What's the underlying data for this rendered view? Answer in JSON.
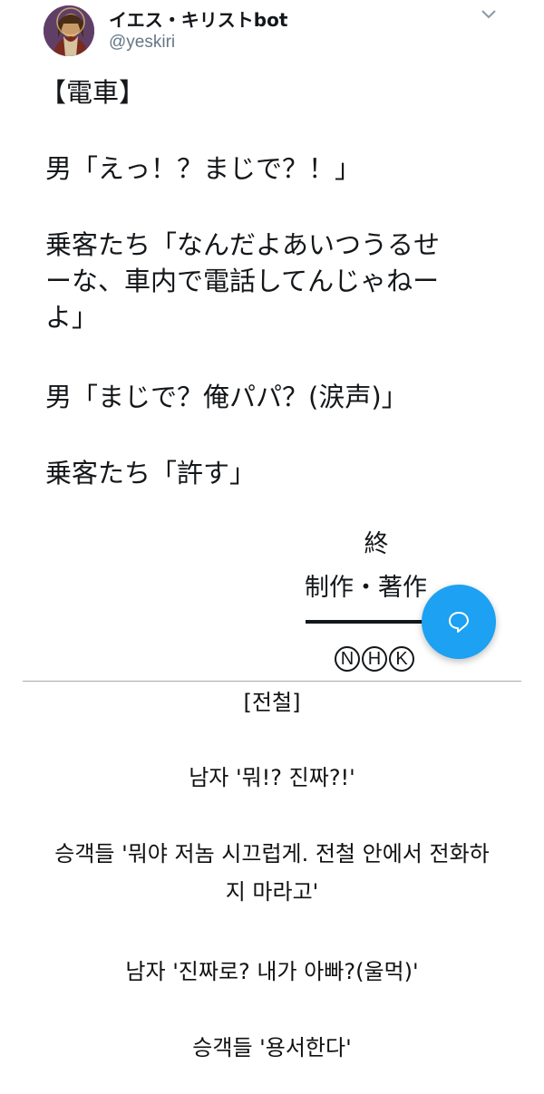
{
  "tweet": {
    "display_name": "イエス・キリストbot",
    "handle": "@yeskiri",
    "colors": {
      "avatar_bg": "#8a5ac6",
      "handle": "#657786",
      "accent": "#1da1f2"
    }
  },
  "japanese": {
    "title": "【電車】",
    "line1": "男「えっ！？まじで？！」",
    "line2_a": "乗客たち「なんだよあいつうるせ",
    "line2_b": "ーな、車内で電話してんじゃねー",
    "line2_c": "よ」",
    "line3": "男「まじで？俺パパ？(涙声)」",
    "line4": "乗客たち「許す」",
    "ending": "終",
    "credit": "制作・著作",
    "nhk_letters": [
      "N",
      "H",
      "K"
    ]
  },
  "korean": {
    "title": "[전철]",
    "line1": "남자 '뭐!? 진짜?!'",
    "line2_a": "승객들 '뭐야 저놈 시끄럽게. 전철 안에서 전화하",
    "line2_b": "지 마라고'",
    "line3": "남자 '진짜로? 내가 아빠?(울먹)'",
    "line4": "승객들 '용서한다'"
  },
  "icons": {
    "caret": "chevron-down-icon",
    "fab": "reply-bubble-icon",
    "avatar": "jesus-portrait"
  }
}
